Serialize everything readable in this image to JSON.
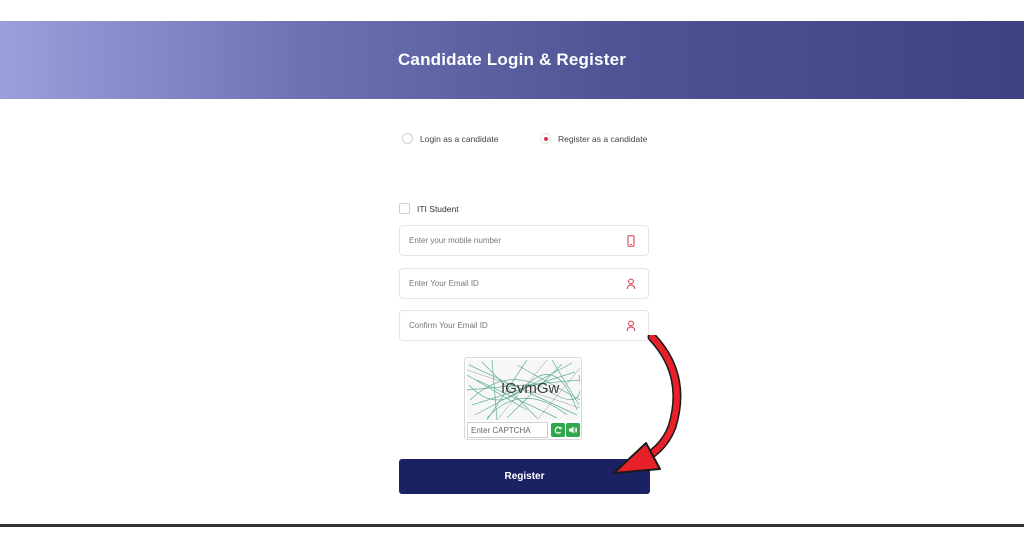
{
  "header": {
    "title": "Candidate Login & Register"
  },
  "mode_options": [
    {
      "label": "Login as a candidate",
      "selected": false
    },
    {
      "label": "Register as a candidate",
      "selected": true
    }
  ],
  "form": {
    "iti_student_label": "ITI Student",
    "mobile_placeholder": "Enter your mobile number",
    "email_placeholder": "Enter Your Email ID",
    "confirm_email_placeholder": "Confirm Your Email ID",
    "captcha": {
      "code": "IGvmGw",
      "input_placeholder": "Enter CAPTCHA",
      "refresh_icon": "refresh-icon",
      "audio_icon": "speaker-icon"
    },
    "submit_label": "Register"
  },
  "colors": {
    "banner_start": "#9aa0dc",
    "banner_end": "#3c4282",
    "accent_red": "#d33a4a",
    "submit_bg": "#1b2263",
    "captcha_button": "#2ea84a",
    "annotation_arrow": "#e8202a"
  }
}
